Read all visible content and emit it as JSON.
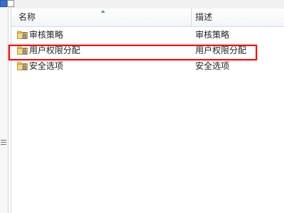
{
  "list": {
    "columns": {
      "name": "名称",
      "description": "描述"
    },
    "sort": {
      "column": "name",
      "direction": "ascending"
    },
    "rows": [
      {
        "name": "审核策略",
        "description": "审核策略",
        "icon": "policy-folder-icon"
      },
      {
        "name": "用户权限分配",
        "description": "用户权限分配",
        "icon": "policy-folder-icon",
        "highlighted": true
      },
      {
        "name": "安全选项",
        "description": "安全选项",
        "icon": "policy-folder-icon"
      }
    ]
  },
  "colors": {
    "highlight": "#e01818",
    "folder": "#e8c468"
  }
}
